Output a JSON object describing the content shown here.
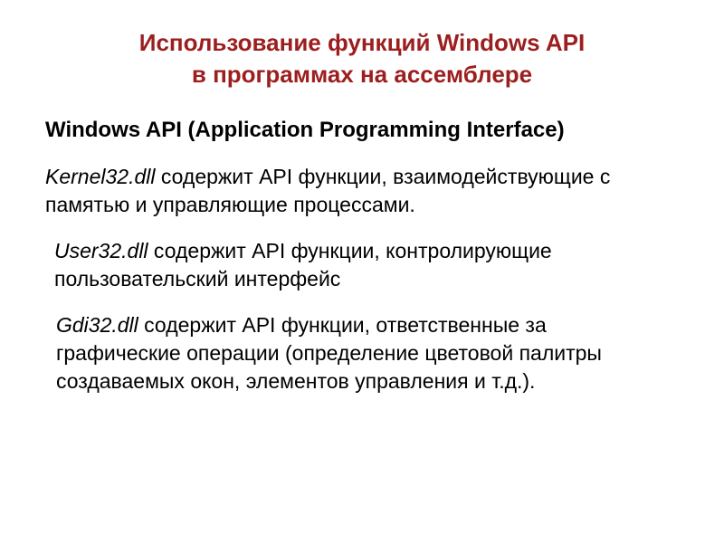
{
  "title": {
    "line1": "Использование функций Windows API",
    "line2": "в программах на ассемблере"
  },
  "heading": "Windows API (Application Programming Interface)",
  "para1": {
    "term": "Kernel32.dll",
    "text": "  содержит API функции, взаимодействующие с памятью и управляющие процессами."
  },
  "para2": {
    "term": "User32.dll",
    "text": "  содержит API функции, контролирующие пользовательский интерфейс"
  },
  "para3": {
    "term": "Gdi32.dll",
    "text": "  содержит API функции, ответственные за графические операции (определение цветовой палитры создаваемых окон, элементов управления и т.д.)."
  }
}
